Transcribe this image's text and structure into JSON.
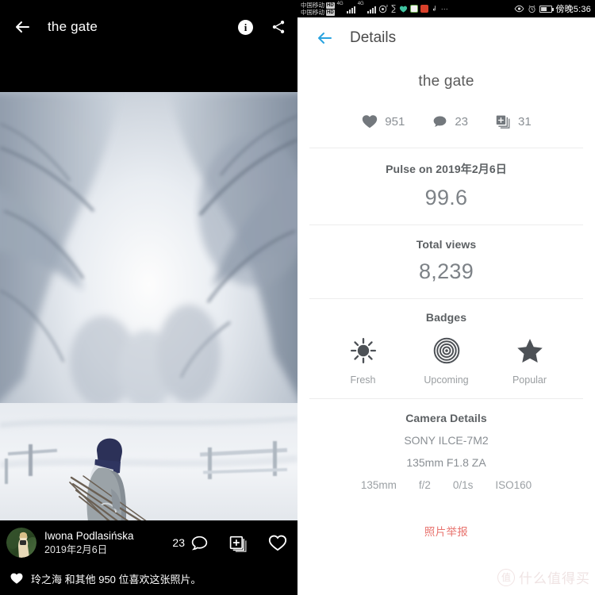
{
  "left": {
    "title": "the gate",
    "icons": {
      "back": "back-arrow-icon",
      "info": "i",
      "share": "share-icon"
    },
    "author": {
      "name": "Iwona Podlasińska",
      "date": "2019年2月6日"
    },
    "comment_count": "23",
    "likes_text": "玲之海 和其他 950 位喜欢这张照片。"
  },
  "status_bar": {
    "carrier_line1": "中国移动",
    "carrier_line2": "中国移动",
    "hd_badge": "HD",
    "net_label_1": "4G",
    "net_label_2": "4G",
    "time": "傍晚5:36"
  },
  "right": {
    "header_title": "Details",
    "photo_title": "the gate",
    "stats": [
      {
        "icon": "heart-icon",
        "value": "951"
      },
      {
        "icon": "comment-icon",
        "value": "23"
      },
      {
        "icon": "collection-icon",
        "value": "31"
      }
    ],
    "pulse": {
      "label": "Pulse on 2019年2月6日",
      "value": "99.6"
    },
    "views": {
      "label": "Total views",
      "value": "8,239"
    },
    "badges": {
      "label": "Badges",
      "items": [
        {
          "icon": "sun-icon",
          "label": "Fresh"
        },
        {
          "icon": "rings-icon",
          "label": "Upcoming"
        },
        {
          "icon": "star-icon",
          "label": "Popular"
        }
      ]
    },
    "camera": {
      "label": "Camera Details",
      "body": "SONY ILCE-7M2",
      "lens": "135mm F1.8 ZA",
      "exif": [
        "135mm",
        "f/2",
        "0/1s",
        "ISO160"
      ]
    },
    "report_label": "照片举报",
    "watermark": {
      "mark": "值",
      "text": "什么值得买"
    }
  },
  "colors": {
    "accent_blue": "#29a3e0",
    "report_red": "#e8736e",
    "stat_gray": "#8a8f94"
  }
}
